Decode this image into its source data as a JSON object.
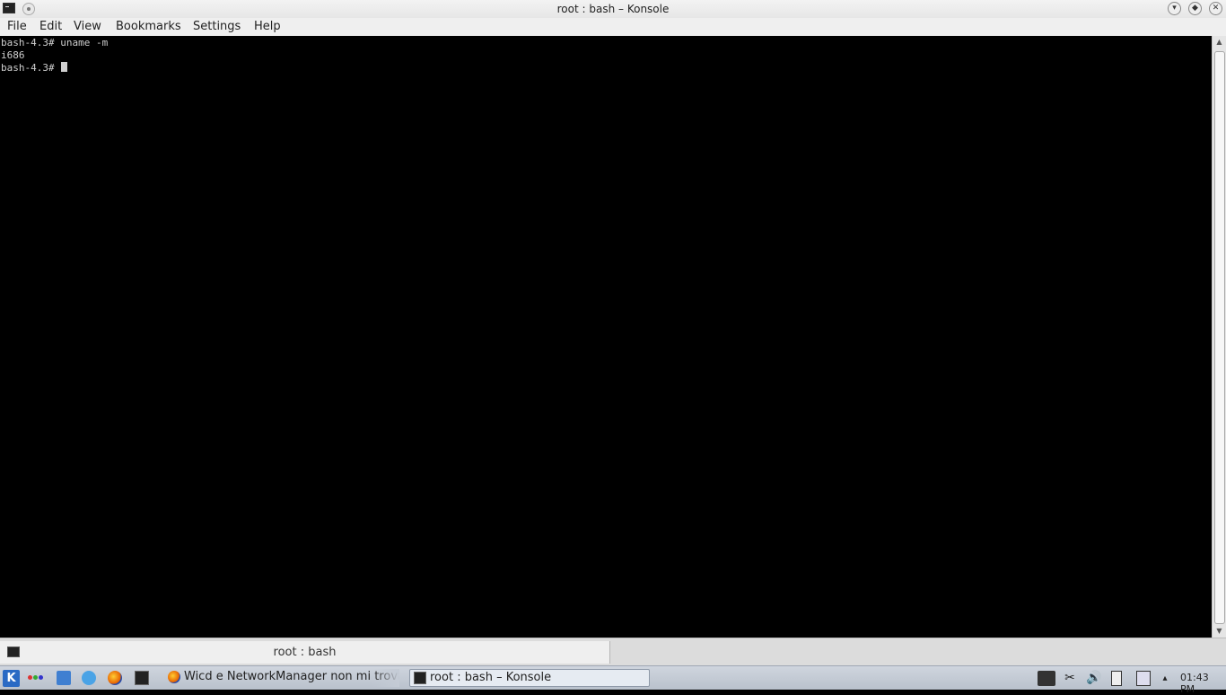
{
  "window": {
    "title": "root : bash – Konsole",
    "minimize_glyph": "▾",
    "maximize_glyph": "◆",
    "close_glyph": "✕"
  },
  "menu": {
    "items": [
      "File",
      "Edit",
      "View",
      "Bookmarks",
      "Settings",
      "Help"
    ]
  },
  "terminal": {
    "lines": [
      "bash-4.3# uname -m",
      "i686",
      "bash-4.3# "
    ]
  },
  "scrollbar": {
    "up_glyph": "▲",
    "down_glyph": "▼"
  },
  "tabs": [
    {
      "label": "root : bash",
      "icon": "terminal-icon"
    }
  ],
  "taskbar": {
    "start_label": "K",
    "tasks": [
      {
        "label": "Wicd e NetworkManager non mi trovano",
        "icon": "firefox-icon"
      },
      {
        "label": "root : bash – Konsole",
        "icon": "terminal-icon"
      }
    ],
    "tray_glyphs": {
      "scissors": "✂",
      "volume": "🔊",
      "expand": "▴"
    },
    "clock": "01:43 PM"
  },
  "colors": {
    "terminal_bg": "#000000",
    "terminal_fg": "#cfcfcf",
    "active_task_bg": "#e6ebf2"
  }
}
